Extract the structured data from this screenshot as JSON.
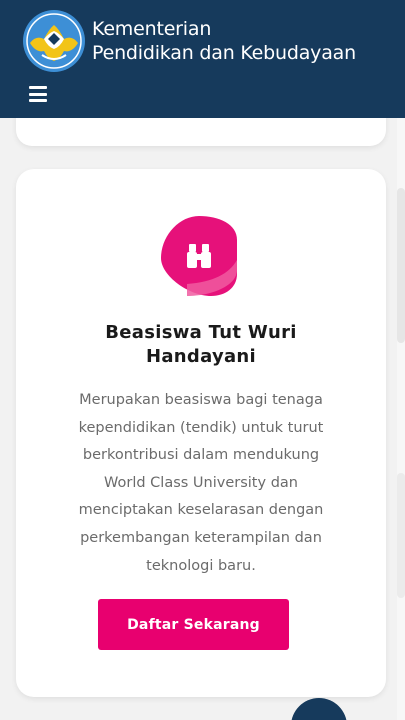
{
  "header": {
    "org_name_line1": "Kementerian",
    "org_name_line2": "Pendidikan dan Kebudayaan",
    "logo_icon": "tut-wuri-handayani-logo",
    "menu_icon": "hamburger-menu-icon",
    "background_color": "#163a5c"
  },
  "card": {
    "icon": "binoculars-icon",
    "title_line1": "Beasiswa Tut Wuri",
    "title_line2": "Handayani",
    "description_lines": [
      "Merupakan beasiswa bagi tenaga",
      "kependidikan (tendik) untuk turut",
      "berkontribusi dalam mendukung",
      "World Class University dan",
      "menciptakan keselarasan dengan",
      "perkembangan keterampilan dan",
      "teknologi baru."
    ],
    "button_label": "Daftar Sekarang",
    "accent_color": "#e8006f"
  }
}
